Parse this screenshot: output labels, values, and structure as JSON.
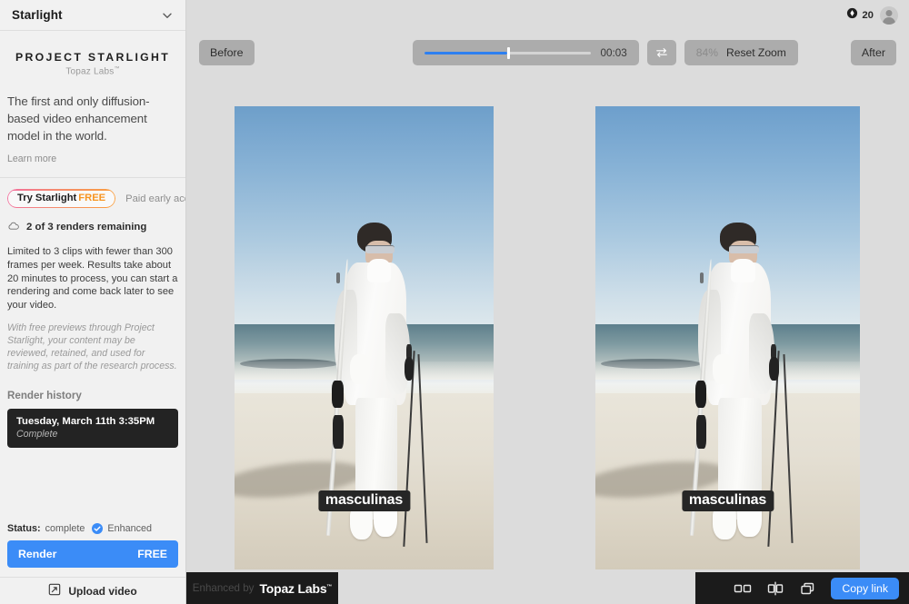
{
  "sidebar": {
    "header_title": "Starlight",
    "brand": {
      "title": "PROJECT STARLIGHT",
      "subtitle": "Topaz Labs",
      "trademark": "™"
    },
    "tagline": "The first and only diffusion-based video enhancement model in the world.",
    "learn_more": "Learn more",
    "plan": {
      "try_label": "Try Starlight",
      "try_free": "FREE",
      "paid_label": "Paid early access"
    },
    "renders_remaining": "2 of 3 renders remaining",
    "limit_text": "Limited to 3 clips with fewer than 300 frames per week. Results take about 20 minutes to process, you can start a rendering and come back later to see your video.",
    "policy_text": "With free previews through Project Starlight, your content may be reviewed, retained, and used for training as part of the research process.",
    "render_history_label": "Render history",
    "history": [
      {
        "date": "Tuesday, March 11th 3:35PM",
        "state": "Complete"
      }
    ],
    "status": {
      "label": "Status:",
      "value": "complete",
      "enhanced_label": "Enhanced"
    },
    "render_button": {
      "label": "Render",
      "badge": "FREE"
    },
    "upload_button": "Upload video"
  },
  "topbar": {
    "credits": "20",
    "credits_icon": "coin-icon",
    "avatar_icon": "user-avatar-icon"
  },
  "toolbar": {
    "before_label": "Before",
    "after_label": "After",
    "time": "00:03",
    "progress_pct": 50,
    "swap_icon": "swap-arrows-icon",
    "zoom_pct": "84%",
    "reset_zoom_label": "Reset Zoom"
  },
  "video": {
    "subtitle": "masculinas",
    "watermark_prefix": "Enhanced by",
    "watermark_brand": "Topaz Labs",
    "watermark_tm": "™"
  },
  "bottombar": {
    "view_side_by_side_icon": "side-by-side-view-icon",
    "view_split_icon": "split-view-icon",
    "view_overlay_icon": "overlay-view-icon",
    "copy_link_label": "Copy link"
  },
  "colors": {
    "accent_blue": "#3b8cf7",
    "panel_gray": "#dcdcdc",
    "sidebar_bg": "#f1f1f1",
    "dark": "#1b1b1b",
    "free_orange": "#f79522"
  }
}
